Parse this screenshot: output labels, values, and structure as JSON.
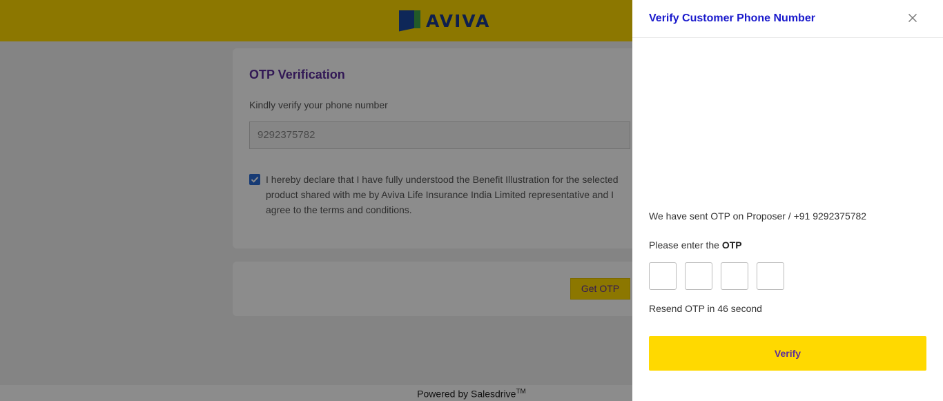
{
  "brand": {
    "name": "AVIVA",
    "primary_color": "#ffd900",
    "accent_color": "#5b2d9c"
  },
  "otp_card": {
    "title": "OTP Verification",
    "subtitle": "Kindly verify your phone number",
    "phone_value": "9292375782",
    "declaration_checked": true,
    "declaration_text": "I hereby declare that I have fully understood the Benefit Illustration for the selected product shared with me by Aviva Life Insurance India Limited representative and I agree to the terms and conditions."
  },
  "actions": {
    "get_otp_label": "Get OTP"
  },
  "footer": {
    "text": "Powered by Salesdrive",
    "trademark": "TM"
  },
  "drawer": {
    "title": "Verify Customer Phone Number",
    "close_icon": "close-icon",
    "sent_message": "We have sent OTP on Proposer / +91 9292375782",
    "enter_prefix": "Please enter the ",
    "enter_bold": "OTP",
    "otp_digits": [
      "",
      "",
      "",
      ""
    ],
    "resend_text": "Resend OTP in 46 second",
    "verify_label": "Verify"
  }
}
